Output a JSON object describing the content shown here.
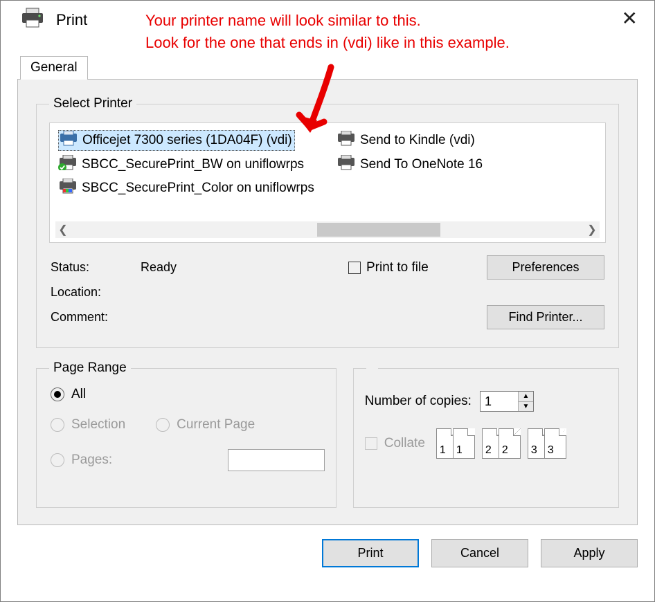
{
  "window": {
    "title": "Print",
    "tab_general": "General"
  },
  "annotation": {
    "line1": "Your printer name will look similar to this.",
    "line2": "Look for the one that ends in (vdi) like in this example."
  },
  "printer_group": {
    "legend": "Select Printer",
    "items": [
      {
        "name": "Officejet 7300 series (1DA04F) (vdi)",
        "selected": true
      },
      {
        "name": "Send to Kindle (vdi)"
      },
      {
        "name": "SBCC_SecurePrint_BW on uniflowrps"
      },
      {
        "name": "Send To OneNote 16"
      },
      {
        "name": "SBCC_SecurePrint_Color on uniflowrps"
      }
    ]
  },
  "status": {
    "status_label": "Status:",
    "status_value": "Ready",
    "location_label": "Location:",
    "comment_label": "Comment:",
    "print_to_file": "Print to file",
    "preferences_btn": "Preferences",
    "find_printer_btn": "Find Printer..."
  },
  "page_range": {
    "legend": "Page Range",
    "all": "All",
    "selection": "Selection",
    "current_page": "Current Page",
    "pages": "Pages:"
  },
  "copies": {
    "label": "Number of copies:",
    "value": "1",
    "collate_label": "Collate",
    "preview": [
      "1",
      "1",
      "2",
      "2",
      "3",
      "3"
    ]
  },
  "buttons": {
    "print": "Print",
    "cancel": "Cancel",
    "apply": "Apply"
  }
}
